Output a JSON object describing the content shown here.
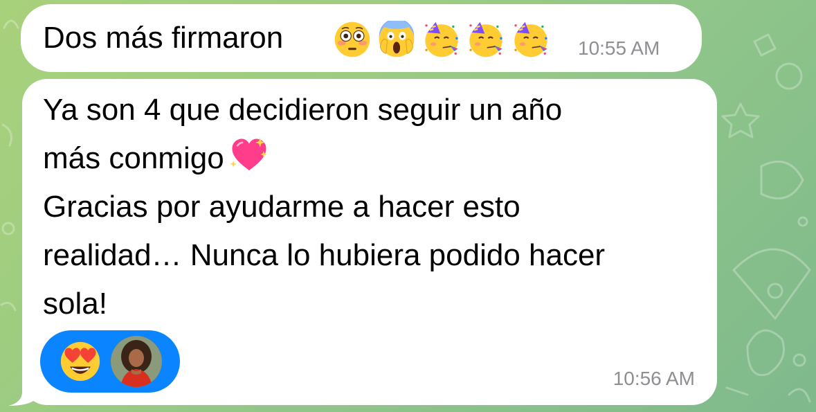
{
  "messages": [
    {
      "text": "Dos más firmaron",
      "emojis": [
        "flushed-face-icon",
        "screaming-face-icon",
        "partying-face-icon",
        "partying-face-icon",
        "partying-face-icon"
      ],
      "time": "10:55 AM"
    },
    {
      "lines": [
        "Ya son 4 que decidieron seguir un año",
        "más conmigo",
        "Gracias por ayudarme a hacer esto",
        "realidad… Nunca lo hubiera podido hacer",
        "sola!"
      ],
      "inline_emoji": "sparkling-heart-icon",
      "reaction": {
        "emoji": "heart-eyes-face-icon",
        "reactor": "user-avatar"
      },
      "time": "10:56 AM"
    }
  ],
  "colors": {
    "background_start": "#a9d17b",
    "background_end": "#7fb98c",
    "bubble": "#ffffff",
    "time": "#8e8e93",
    "reaction_pill": "#0a84ff"
  }
}
